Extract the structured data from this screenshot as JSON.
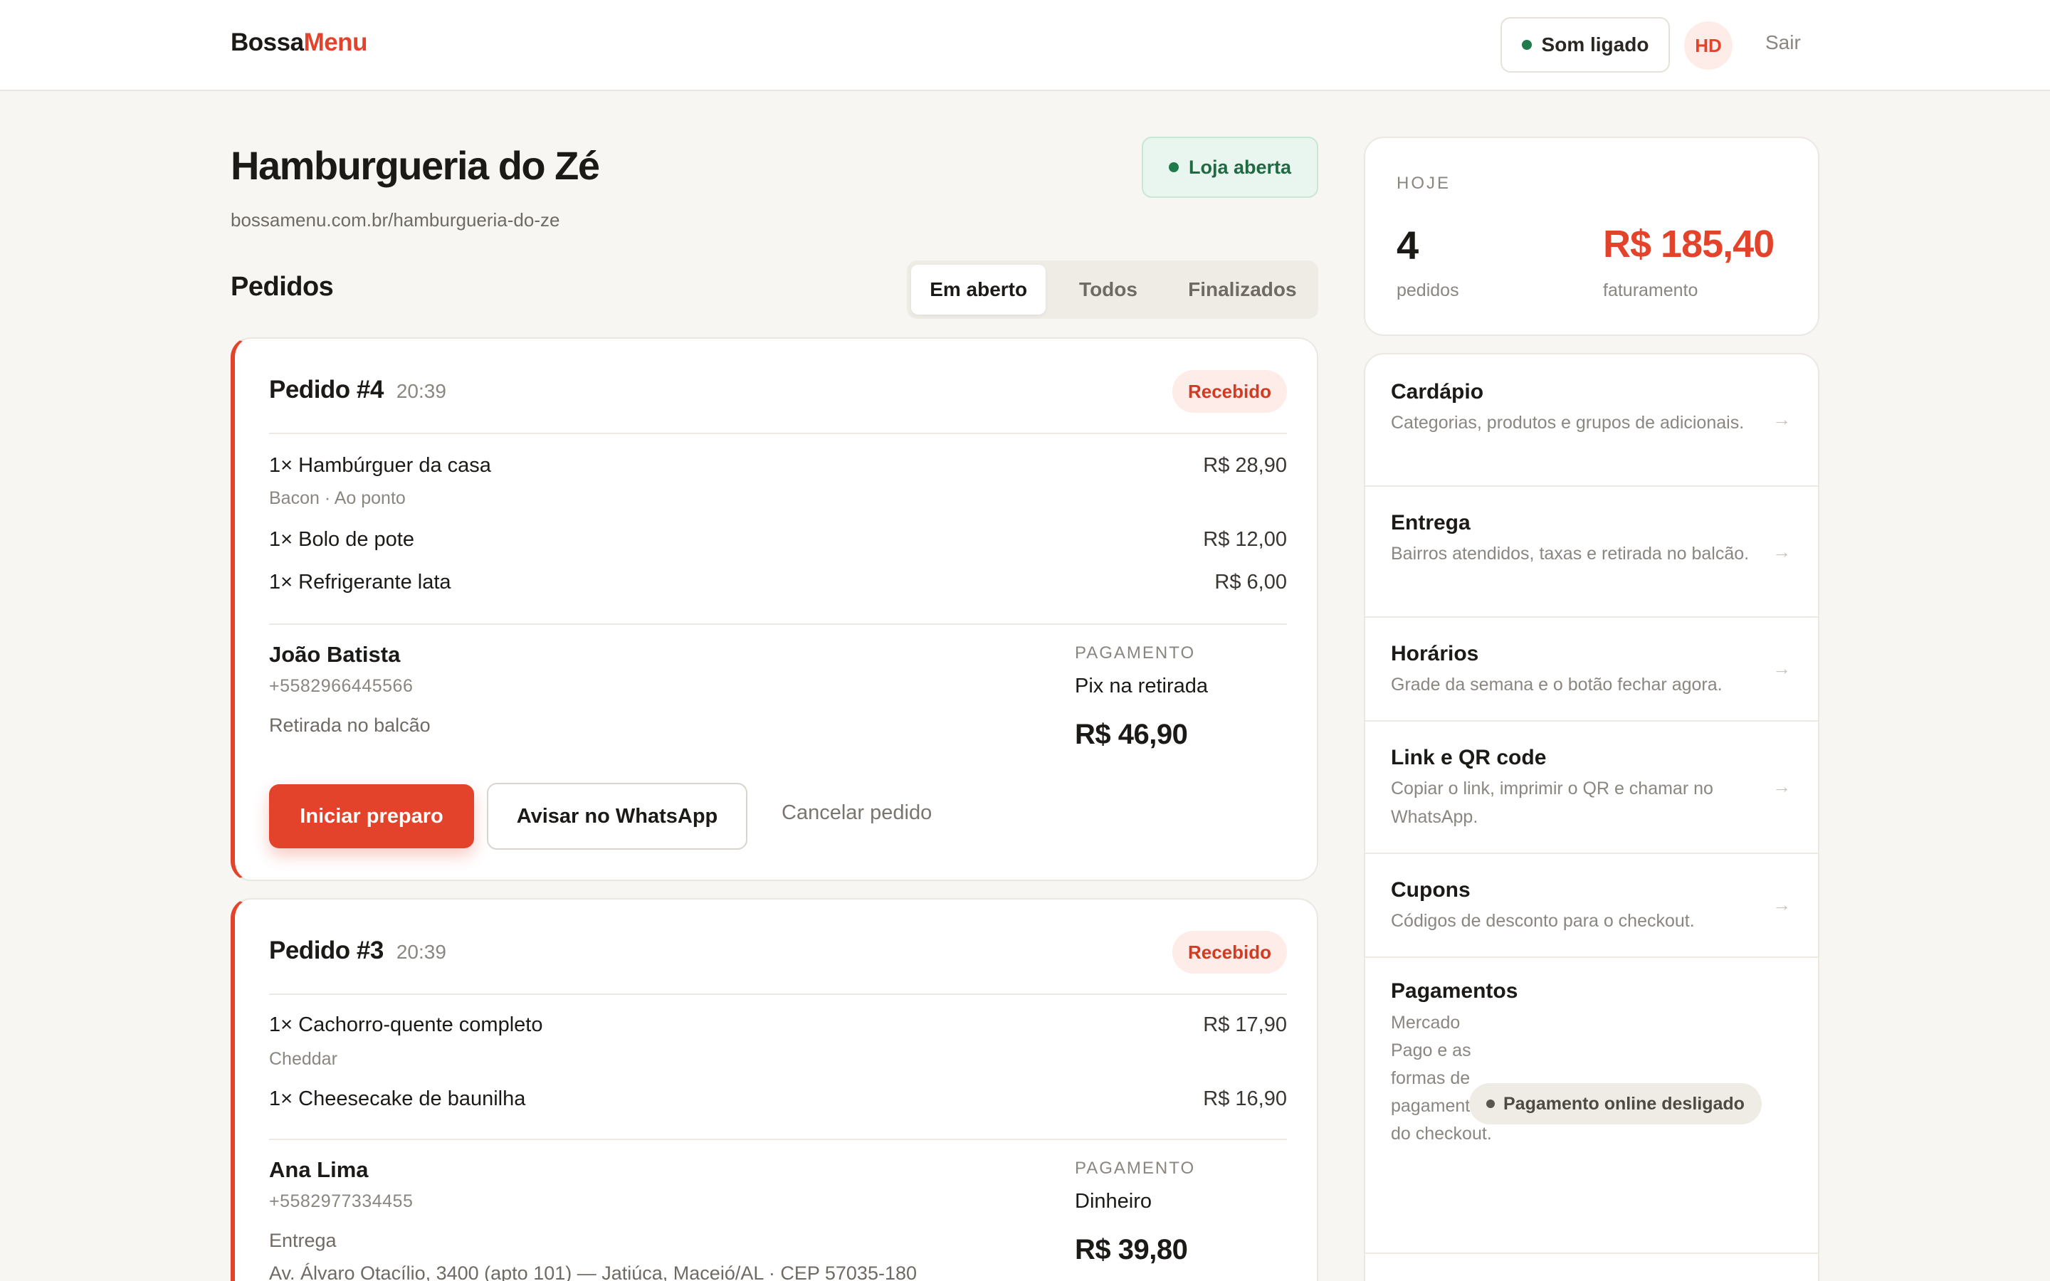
{
  "app": {
    "logo_part1": "Bossa",
    "logo_part2": "Menu"
  },
  "topbar": {
    "sound_label": "Som ligado",
    "avatar_initials": "HD",
    "logout_label": "Sair"
  },
  "store": {
    "name": "Hamburgueria do Zé",
    "url": "bossamenu.com.br/hamburgueria-do-ze",
    "status_label": "Loja aberta"
  },
  "orders": {
    "title": "Pedidos",
    "tabs": [
      {
        "label": "Em aberto",
        "active": true
      },
      {
        "label": "Todos",
        "active": false
      },
      {
        "label": "Finalizados",
        "active": false
      }
    ],
    "list": [
      {
        "number": "Pedido #4",
        "time": "20:39",
        "status": "Recebido",
        "items": [
          {
            "name": "1× Hambúrguer da casa",
            "price": "R$ 28,90",
            "note": "Bacon · Ao ponto"
          },
          {
            "name": "1× Bolo de pote",
            "price": "R$ 12,00"
          },
          {
            "name": "1× Refrigerante lata",
            "price": "R$ 6,00"
          }
        ],
        "customer": {
          "name": "João Batista",
          "phone": "+5582966445566",
          "mode": "Retirada no balcão"
        },
        "payment": {
          "label": "PAGAMENTO",
          "method": "Pix na retirada",
          "total": "R$ 46,90"
        },
        "actions": {
          "primary": "Iniciar preparo",
          "secondary": "Avisar no WhatsApp",
          "cancel": "Cancelar pedido"
        }
      },
      {
        "number": "Pedido #3",
        "time": "20:39",
        "status": "Recebido",
        "items": [
          {
            "name": "1× Cachorro-quente completo",
            "price": "R$ 17,90",
            "note": "Cheddar"
          },
          {
            "name": "1× Cheesecake de baunilha",
            "price": "R$ 16,90"
          }
        ],
        "customer": {
          "name": "Ana Lima",
          "phone": "+5582977334455",
          "mode": "Entrega",
          "address": "Av. Álvaro Otacílio, 3400 (apto 101) — Jatiúca, Maceió/AL · CEP 57035-180"
        },
        "payment": {
          "label": "PAGAMENTO",
          "method": "Dinheiro",
          "total": "R$ 39,80"
        }
      }
    ]
  },
  "today": {
    "label": "HOJE",
    "orders_count": "4",
    "orders_label": "pedidos",
    "revenue": "R$ 185,40",
    "revenue_label": "faturamento"
  },
  "menu": {
    "items": [
      {
        "title": "Cardápio",
        "desc": "Categorias, produtos e grupos de adicionais."
      },
      {
        "title": "Entrega",
        "desc": "Bairros atendidos, taxas e retirada no balcão."
      },
      {
        "title": "Horários",
        "desc": "Grade da semana e o botão fechar agora."
      },
      {
        "title": "Link e QR code",
        "desc": "Copiar o link, imprimir o QR e chamar no WhatsApp."
      },
      {
        "title": "Cupons",
        "desc": "Códigos de desconto para o checkout."
      },
      {
        "title": "Pagamentos",
        "desc": "Mercado Pago e as formas de pagamento do checkout.",
        "badge": "Pagamento online desligado"
      }
    ],
    "arrow": "→"
  },
  "colors": {
    "accent": "#e4432b",
    "success": "#1f7a4c",
    "background": "#f7f6f3"
  }
}
